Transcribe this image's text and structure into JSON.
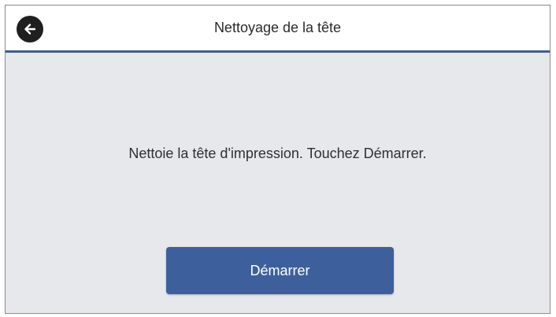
{
  "header": {
    "title": "Nettoyage de la tête",
    "back_icon": "arrow-left-icon"
  },
  "main": {
    "message": "Nettoie la tête d'impression. Touchez Démarrer.",
    "start_label": "Démarrer"
  },
  "colors": {
    "accent": "#3f5d8d",
    "button": "#3d609c",
    "background": "#e7e8ec"
  }
}
